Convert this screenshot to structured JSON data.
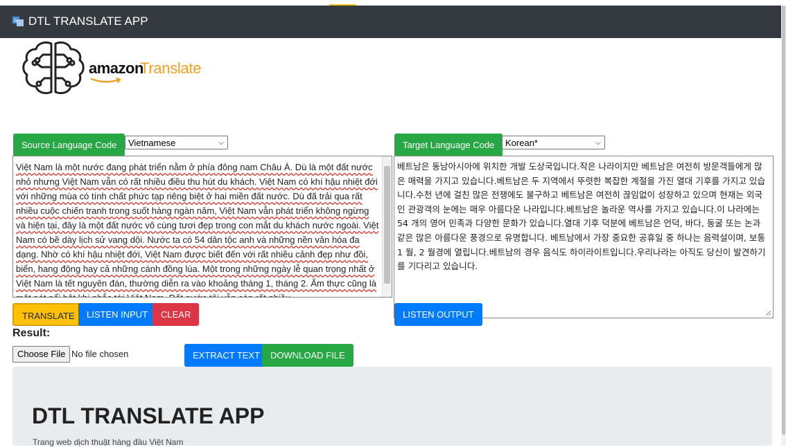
{
  "app": {
    "title": "DTL TRANSLATE APP"
  },
  "logo": {
    "amazon": "amazon",
    "translate": "Translate"
  },
  "source": {
    "label": "Source Language Code",
    "selected": "Vietnamese",
    "text": "Việt Nam là một nước đang phát triển nằm ở phía đông nam Châu Á. Dù là một đất nước nhỏ nhưng Việt Nam vẫn có rất nhiều điều thu hút du khách. Việt Nam có khí hậu nhiệt đới với những mùa có tính chất phức tạp riêng biệt ở hai miền đất nước. Dù đã trải qua rất nhiều cuộc chiến tranh trong suốt hàng ngàn năm, Việt Nam vẫn phát triển không ngừng và hiện tại, đây là một đất nước vô cùng tươi đẹp trong con mắt du khách nước ngoài. Việt Nam có bề dày lịch sử vang dội. Nước ta có 54 dân tộc anh và những nền văn hóa đa dạng. Nhờ có khí hậu nhiệt đới, Việt Nam được biết đến với rất nhiều cảnh đẹp như đồi, biển, hang động hay cả những cánh đồng lúa. Một trong những ngày lễ quan trọng nhất ở Việt Nam là tết nguyên đán, thường diễn ra vào khoảng tháng 1, tháng 2. Ẩm thực cũng là một nét nổi bật khi nhắc tới Việt Nam. Đất nước tôi vẫn còn rất nhiều"
  },
  "target": {
    "label": "Target Language Code",
    "selected": "Korean*",
    "text": "베트남은 동남아시아에 위치한 개발 도상국입니다.작은 나라이지만 베트남은 여전히 방문객들에게 많은 매력을 가지고 있습니다.베트남은 두 지역에서 뚜렷한 복잡한 계절을 가진 열대 기후를 가지고 있습니다.수천 년에 걸친 많은 전쟁에도 불구하고 베트남은 여전히 끊임없이 성장하고 있으며 현재는 외국인 관광객의 눈에는 매우 아름다운 나라입니다.베트남은 놀라운 역사를 가지고 있습니다.이 나라에는 54 개의 영어 민족과 다양한 문화가 있습니다.열대 기후 덕분에 베트남은 언덕, 바다, 동굴 또는 논과 같은 많은 아름다운 풍경으로 유명합니다. 베트남에서 가장 중요한 공휴일 중 하나는 음력설이며, 보통 1 월, 2 월경에 열립니다.베트남의 경우 음식도 하이라이트입니다.우리나라는 아직도 당신이 발견하기를 기다리고 있습니다."
  },
  "buttons": {
    "translate": "TRANSLATE",
    "listen_input": "LISTEN INPUT",
    "clear": "CLEAR",
    "listen_output": "LISTEN OUTPUT",
    "extract_text": "EXTRACT TEXT",
    "download_file": "DOWNLOAD FILE"
  },
  "result": {
    "label": "Result:"
  },
  "file": {
    "choose": "Choose File",
    "status": "No file chosen"
  },
  "jumbotron": {
    "title": "DTL TRANSLATE APP",
    "subtitle": "Trang web dịch thuật hàng đầu Việt Nam"
  },
  "colors": {
    "navbar": "#343a40",
    "green": "#28a745",
    "blue": "#007bff",
    "red": "#dc3545",
    "yellow": "#ffc107",
    "translate_orange": "#f0a020"
  }
}
